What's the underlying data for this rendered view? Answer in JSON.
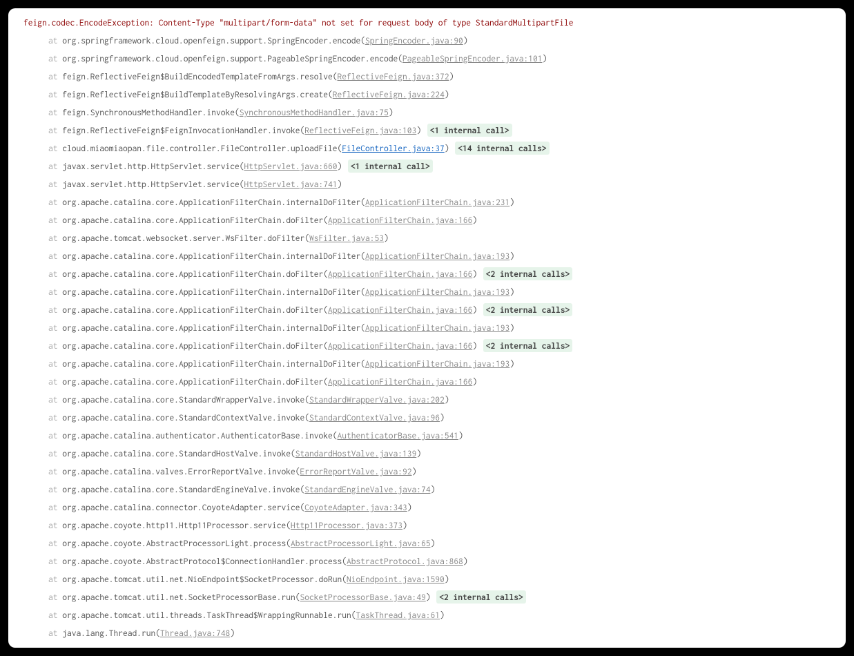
{
  "exception": "feign.codec.EncodeException: Content-Type \"multipart/form-data\" not set for request body of type StandardMultipartFile",
  "frames": [
    {
      "method": "org.springframework.cloud.openfeign.support.SpringEncoder.encode",
      "link": "SpringEncoder.java:90",
      "blue": false,
      "note": ""
    },
    {
      "method": "org.springframework.cloud.openfeign.support.PageableSpringEncoder.encode",
      "link": "PageableSpringEncoder.java:101",
      "blue": false,
      "note": ""
    },
    {
      "method": "feign.ReflectiveFeign$BuildEncodedTemplateFromArgs.resolve",
      "link": "ReflectiveFeign.java:372",
      "blue": false,
      "note": ""
    },
    {
      "method": "feign.ReflectiveFeign$BuildTemplateByResolvingArgs.create",
      "link": "ReflectiveFeign.java:224",
      "blue": false,
      "note": ""
    },
    {
      "method": "feign.SynchronousMethodHandler.invoke",
      "link": "SynchronousMethodHandler.java:75",
      "blue": false,
      "note": ""
    },
    {
      "method": "feign.ReflectiveFeign$FeignInvocationHandler.invoke",
      "link": "ReflectiveFeign.java:103",
      "blue": false,
      "note": "<1 internal call>"
    },
    {
      "method": "cloud.miaomiaopan.file.controller.FileController.uploadFile",
      "link": "FileController.java:37",
      "blue": true,
      "note": "<14 internal calls>"
    },
    {
      "method": "javax.servlet.http.HttpServlet.service",
      "link": "HttpServlet.java:660",
      "blue": false,
      "note": "<1 internal call>"
    },
    {
      "method": "javax.servlet.http.HttpServlet.service",
      "link": "HttpServlet.java:741",
      "blue": false,
      "note": ""
    },
    {
      "method": "org.apache.catalina.core.ApplicationFilterChain.internalDoFilter",
      "link": "ApplicationFilterChain.java:231",
      "blue": false,
      "note": ""
    },
    {
      "method": "org.apache.catalina.core.ApplicationFilterChain.doFilter",
      "link": "ApplicationFilterChain.java:166",
      "blue": false,
      "note": ""
    },
    {
      "method": "org.apache.tomcat.websocket.server.WsFilter.doFilter",
      "link": "WsFilter.java:53",
      "blue": false,
      "note": ""
    },
    {
      "method": "org.apache.catalina.core.ApplicationFilterChain.internalDoFilter",
      "link": "ApplicationFilterChain.java:193",
      "blue": false,
      "note": ""
    },
    {
      "method": "org.apache.catalina.core.ApplicationFilterChain.doFilter",
      "link": "ApplicationFilterChain.java:166",
      "blue": false,
      "note": "<2 internal calls>"
    },
    {
      "method": "org.apache.catalina.core.ApplicationFilterChain.internalDoFilter",
      "link": "ApplicationFilterChain.java:193",
      "blue": false,
      "note": ""
    },
    {
      "method": "org.apache.catalina.core.ApplicationFilterChain.doFilter",
      "link": "ApplicationFilterChain.java:166",
      "blue": false,
      "note": "<2 internal calls>"
    },
    {
      "method": "org.apache.catalina.core.ApplicationFilterChain.internalDoFilter",
      "link": "ApplicationFilterChain.java:193",
      "blue": false,
      "note": ""
    },
    {
      "method": "org.apache.catalina.core.ApplicationFilterChain.doFilter",
      "link": "ApplicationFilterChain.java:166",
      "blue": false,
      "note": "<2 internal calls>"
    },
    {
      "method": "org.apache.catalina.core.ApplicationFilterChain.internalDoFilter",
      "link": "ApplicationFilterChain.java:193",
      "blue": false,
      "note": ""
    },
    {
      "method": "org.apache.catalina.core.ApplicationFilterChain.doFilter",
      "link": "ApplicationFilterChain.java:166",
      "blue": false,
      "note": ""
    },
    {
      "method": "org.apache.catalina.core.StandardWrapperValve.invoke",
      "link": "StandardWrapperValve.java:202",
      "blue": false,
      "note": ""
    },
    {
      "method": "org.apache.catalina.core.StandardContextValve.invoke",
      "link": "StandardContextValve.java:96",
      "blue": false,
      "note": ""
    },
    {
      "method": "org.apache.catalina.authenticator.AuthenticatorBase.invoke",
      "link": "AuthenticatorBase.java:541",
      "blue": false,
      "note": ""
    },
    {
      "method": "org.apache.catalina.core.StandardHostValve.invoke",
      "link": "StandardHostValve.java:139",
      "blue": false,
      "note": ""
    },
    {
      "method": "org.apache.catalina.valves.ErrorReportValve.invoke",
      "link": "ErrorReportValve.java:92",
      "blue": false,
      "note": ""
    },
    {
      "method": "org.apache.catalina.core.StandardEngineValve.invoke",
      "link": "StandardEngineValve.java:74",
      "blue": false,
      "note": ""
    },
    {
      "method": "org.apache.catalina.connector.CoyoteAdapter.service",
      "link": "CoyoteAdapter.java:343",
      "blue": false,
      "note": ""
    },
    {
      "method": "org.apache.coyote.http11.Http11Processor.service",
      "link": "Http11Processor.java:373",
      "blue": false,
      "note": ""
    },
    {
      "method": "org.apache.coyote.AbstractProcessorLight.process",
      "link": "AbstractProcessorLight.java:65",
      "blue": false,
      "note": ""
    },
    {
      "method": "org.apache.coyote.AbstractProtocol$ConnectionHandler.process",
      "link": "AbstractProtocol.java:868",
      "blue": false,
      "note": ""
    },
    {
      "method": "org.apache.tomcat.util.net.NioEndpoint$SocketProcessor.doRun",
      "link": "NioEndpoint.java:1590",
      "blue": false,
      "note": ""
    },
    {
      "method": "org.apache.tomcat.util.net.SocketProcessorBase.run",
      "link": "SocketProcessorBase.java:49",
      "blue": false,
      "note": "<2 internal calls>"
    },
    {
      "method": "org.apache.tomcat.util.threads.TaskThread$WrappingRunnable.run",
      "link": "TaskThread.java:61",
      "blue": false,
      "note": ""
    },
    {
      "method": "java.lang.Thread.run",
      "link": "Thread.java:748",
      "blue": false,
      "note": ""
    }
  ],
  "at_label": "at"
}
